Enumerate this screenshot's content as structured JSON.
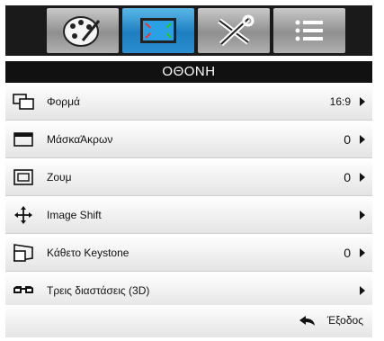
{
  "menu_tabs": [
    {
      "icon": "palette-icon",
      "active": false
    },
    {
      "icon": "display-icon",
      "active": true
    },
    {
      "icon": "tools-icon",
      "active": false
    },
    {
      "icon": "list-icon",
      "active": false
    }
  ],
  "title": "ΟΘΟΝΗ",
  "items": [
    {
      "label": "Φορμά",
      "value": "16:9",
      "icon": "aspect-ratio-icon"
    },
    {
      "label": "ΜάσκαΆκρων",
      "value": "0",
      "icon": "edge-mask-icon"
    },
    {
      "label": "Ζουμ",
      "value": "0",
      "icon": "zoom-icon"
    },
    {
      "label": "Image Shift",
      "value": "",
      "icon": "move-arrows-icon"
    },
    {
      "label": "Κάθετο Keystone",
      "value": "0",
      "icon": "keystone-icon"
    },
    {
      "label": "Τρεις διαστάσεις (3D)",
      "value": "",
      "icon": "3d-glasses-icon"
    }
  ],
  "exit": {
    "label": "Έξοδος",
    "icon": "return-arrow-icon"
  }
}
